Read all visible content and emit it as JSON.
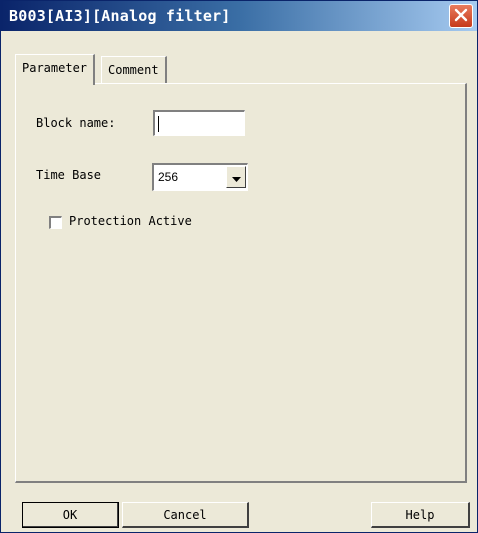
{
  "window": {
    "title": "B003[AI3][Analog filter]"
  },
  "tabs": [
    {
      "label": "Parameter",
      "active": true
    },
    {
      "label": "Comment",
      "active": false
    }
  ],
  "form": {
    "block_name_label": "Block name:",
    "block_name_value": "",
    "time_base_label": "Time Base",
    "time_base_value": "256",
    "protection_label": "Protection Active",
    "protection_checked": false
  },
  "buttons": {
    "ok": "OK",
    "cancel": "Cancel",
    "help": "Help"
  },
  "icons": {
    "close": "close-icon",
    "dropdown": "chevron-down-icon"
  },
  "colors": {
    "dialog_bg": "#ece9d8",
    "titlebar_dark": "#0a246a",
    "titlebar_light": "#a6caf0",
    "close_red": "#c63a1b"
  }
}
